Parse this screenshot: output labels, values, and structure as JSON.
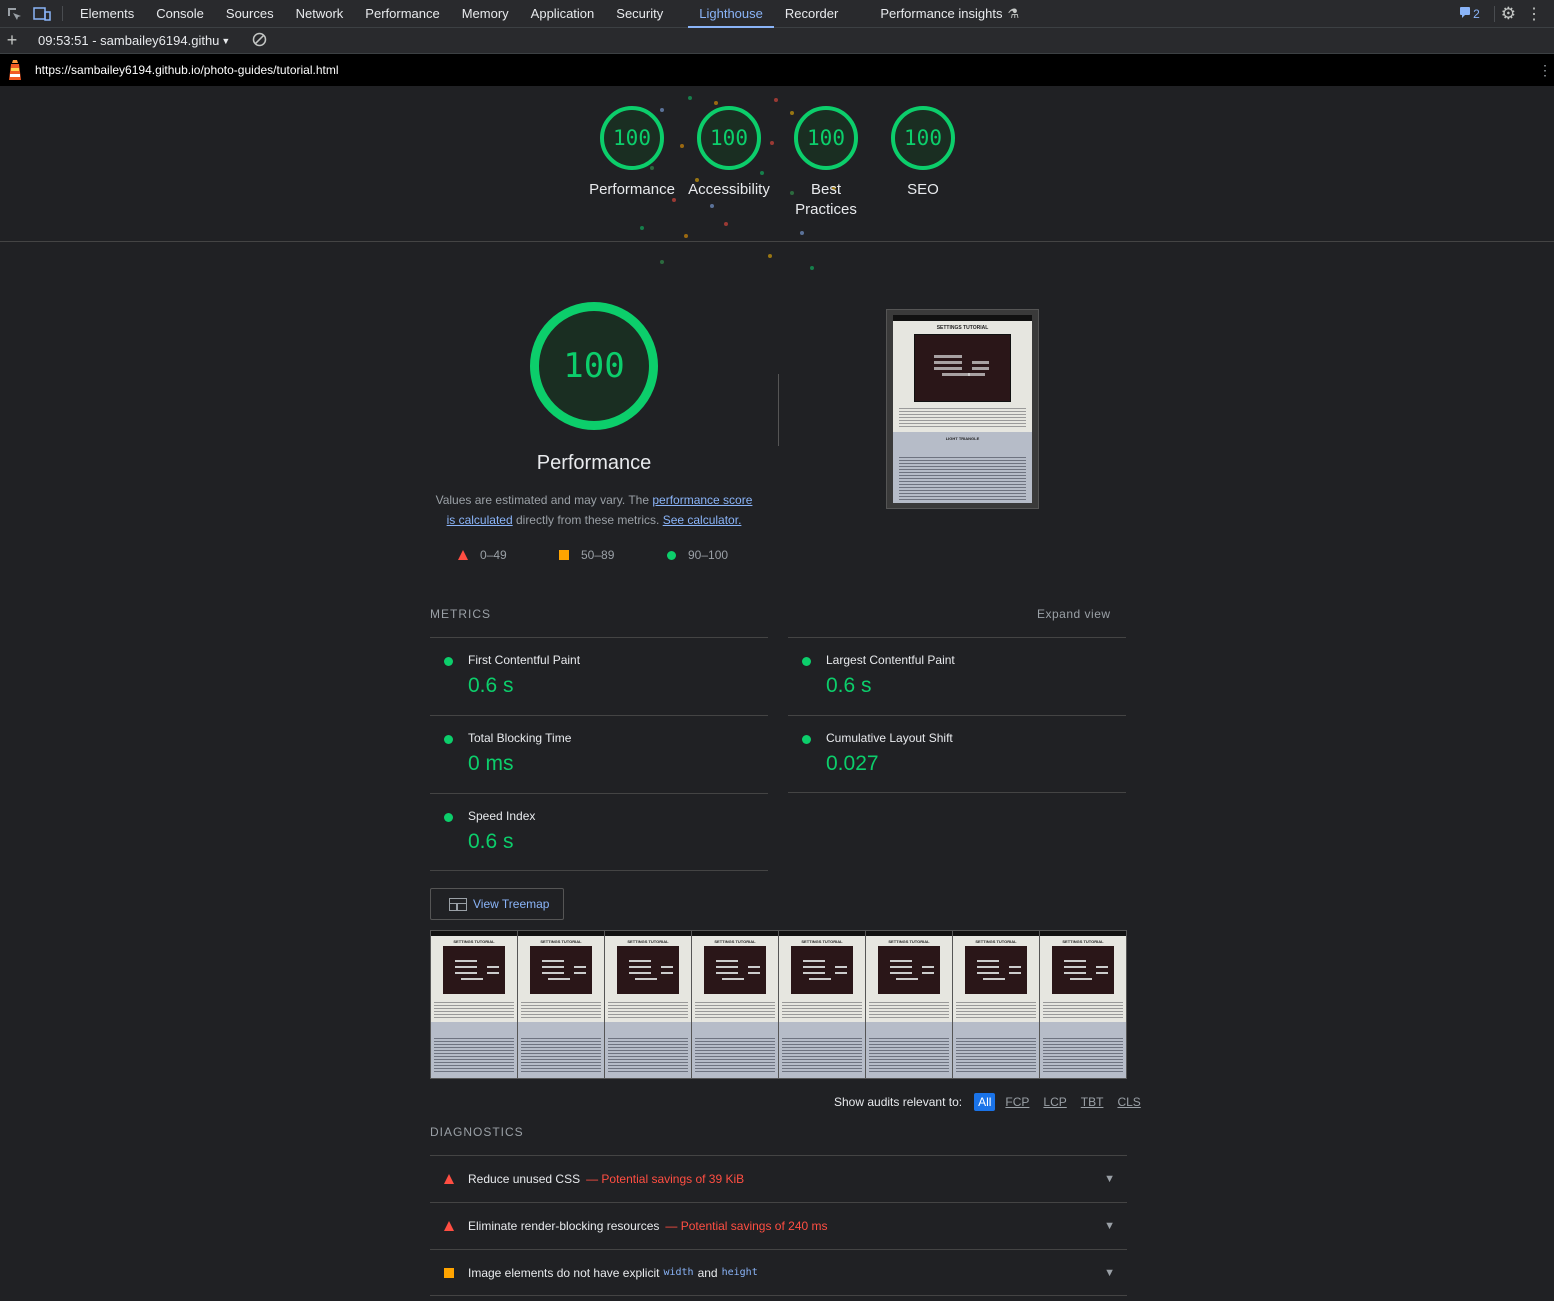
{
  "devtools": {
    "tabs": [
      "Elements",
      "Console",
      "Sources",
      "Network",
      "Performance",
      "Memory",
      "Application",
      "Security",
      "Lighthouse",
      "Recorder",
      "Performance insights"
    ],
    "active_tab": "Lighthouse",
    "issues_count": "2"
  },
  "lighthouse_toolbar": {
    "report_label": "09:53:51 - sambailey6194.githu"
  },
  "url": "https://sambailey6194.github.io/photo-guides/tutorial.html",
  "scores": [
    {
      "value": "100",
      "label": "Performance"
    },
    {
      "value": "100",
      "label": "Accessibility"
    },
    {
      "value": "100",
      "label": "Best Practices"
    },
    {
      "value": "100",
      "label": "SEO"
    }
  ],
  "performance": {
    "score": "100",
    "title": "Performance",
    "desc_1": "Values are estimated and may vary. The ",
    "desc_link_1": "performance score is calculated",
    "desc_2": " directly from these metrics. ",
    "desc_link_2": "See calculator.",
    "legend": {
      "fail": "0–49",
      "average": "50–89",
      "pass": "90–100"
    }
  },
  "screenshot": {
    "title": "SETTINGS TUTORIAL",
    "section_title": "LIGHT TRIANGLE"
  },
  "metrics": {
    "heading": "METRICS",
    "expand_label": "Expand view",
    "items": [
      {
        "name": "First Contentful Paint",
        "value": "0.6 s"
      },
      {
        "name": "Largest Contentful Paint",
        "value": "0.6 s"
      },
      {
        "name": "Total Blocking Time",
        "value": "0 ms"
      },
      {
        "name": "Cumulative Layout Shift",
        "value": "0.027"
      },
      {
        "name": "Speed Index",
        "value": "0.6 s"
      }
    ]
  },
  "treemap_label": "View Treemap",
  "filter": {
    "label": "Show audits relevant to:",
    "options": [
      "All",
      "FCP",
      "LCP",
      "TBT",
      "CLS"
    ],
    "active": "All"
  },
  "diagnostics": {
    "heading": "DIAGNOSTICS",
    "audits": [
      {
        "title": "Reduce unused CSS",
        "savings": "— Potential savings of 39 KiB",
        "status": "fail"
      },
      {
        "title": "Eliminate render-blocking resources",
        "savings": "— Potential savings of 240 ms",
        "status": "fail"
      },
      {
        "title_1": "Image elements do not have explicit",
        "code_1": "width",
        "mid": "and",
        "code_2": "height",
        "status": "average"
      }
    ]
  },
  "colors": {
    "pass": "#0cce6b",
    "average": "#ffa400",
    "fail": "#ff4e42",
    "link": "#8ab4f8"
  }
}
